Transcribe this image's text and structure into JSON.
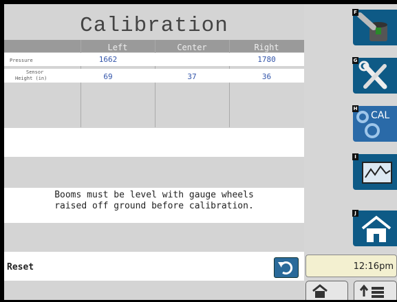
{
  "page": {
    "title": "Calibration"
  },
  "table": {
    "columns": [
      "Left",
      "Center",
      "Right"
    ],
    "rows": [
      {
        "label": "Pressure",
        "values": [
          "1662",
          "",
          "1780"
        ]
      },
      {
        "label1": "Sensor",
        "label2": "Height (in)",
        "values": [
          "69",
          "37",
          "36"
        ]
      }
    ]
  },
  "message": {
    "line1": "Booms must be level with gauge wheels",
    "line2": "raised off ground before calibration."
  },
  "reset": {
    "label": "Reset"
  },
  "sidebar": {
    "buttons": [
      {
        "key": "F"
      },
      {
        "key": "G"
      },
      {
        "key": "H",
        "text": "CAL"
      },
      {
        "key": "I"
      },
      {
        "key": "J"
      }
    ]
  },
  "clock": {
    "time": "12:16pm"
  },
  "colors": {
    "accent": "#0e5a86",
    "value_text": "#3355aa"
  }
}
